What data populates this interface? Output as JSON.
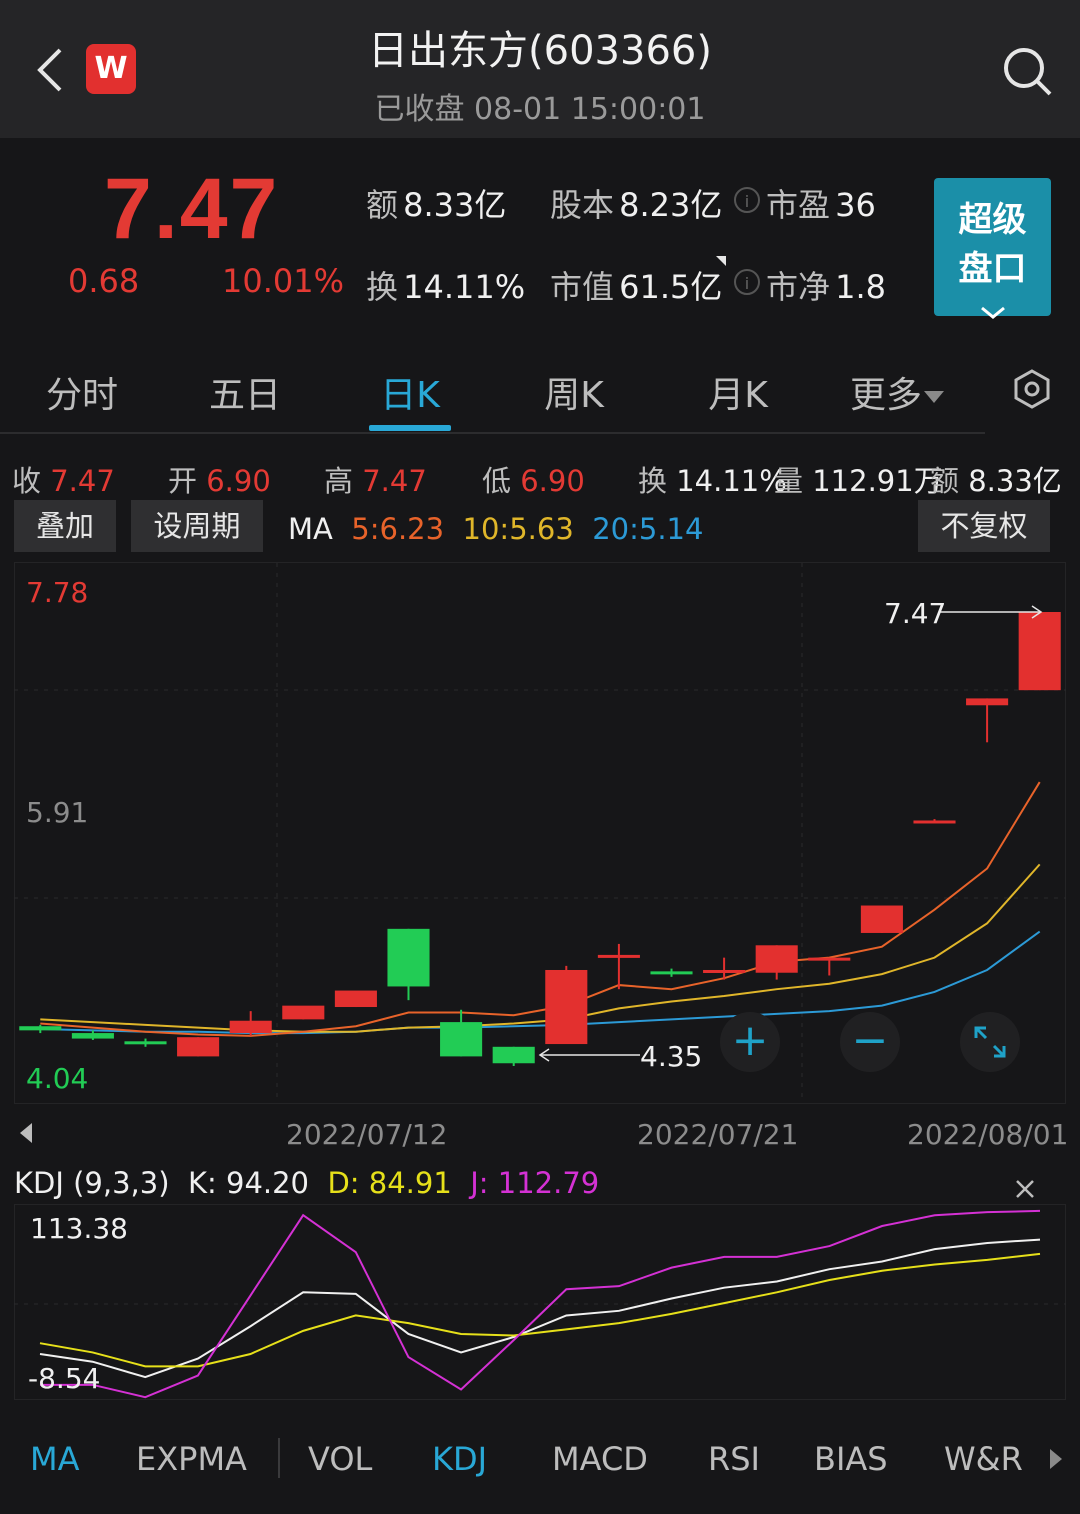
{
  "header": {
    "title": "日出东方(603366)",
    "subtitle": "已收盘 08-01 15:00:01",
    "logo_letter": "W"
  },
  "quote": {
    "price": "7.47",
    "change": "0.68",
    "change_pct": "10.01%",
    "amount_label": "额",
    "amount": "8.33亿",
    "shares_label": "股本",
    "shares": "8.23亿",
    "pe_label": "市盈",
    "pe": "36",
    "turnover_label": "换",
    "turnover": "14.11%",
    "mcap_label": "市值",
    "mcap": "61.5亿",
    "pb_label": "市净",
    "pb": "1.8",
    "super_line1": "超级",
    "super_line2": "盘口"
  },
  "tabs": [
    "分时",
    "五日",
    "日K",
    "周K",
    "月K",
    "更多"
  ],
  "active_tab": "日K",
  "stats": {
    "close_label": "收",
    "close": "7.47",
    "open_label": "开",
    "open": "6.90",
    "high_label": "高",
    "high": "7.47",
    "low_label": "低",
    "low": "6.90",
    "turn_label": "换",
    "turn": "14.11%",
    "vol_label": "量",
    "vol": "112.91万",
    "amt_label": "额",
    "amt": "8.33亿"
  },
  "buttons": {
    "overlay": "叠加",
    "period": "设周期",
    "adjust": "不复权"
  },
  "ma": {
    "label": "MA",
    "ma5": "5:6.23",
    "ma10": "10:5.63",
    "ma20": "20:5.14"
  },
  "colors": {
    "up": "#e3302f",
    "down": "#22cc55",
    "ma5": "#e8632a",
    "ma10": "#e0b62a",
    "ma20": "#2c9ad6",
    "k": "#f0f0f0",
    "d": "#e6e01a",
    "j": "#d431d4",
    "accent": "#29a8d6"
  },
  "chart_data": [
    {
      "type": "candlestick",
      "title": "",
      "y_labels": [
        "7.78",
        "5.91",
        "4.04"
      ],
      "ylim": [
        4.04,
        7.78
      ],
      "x_labels": [
        "2022/07/12",
        "2022/07/21",
        "2022/08/01"
      ],
      "max_marker": "7.47",
      "min_marker": "4.35",
      "candles": [
        {
          "o": 4.45,
          "h": 4.46,
          "c": 4.42,
          "l": 4.4
        },
        {
          "o": 4.4,
          "h": 4.42,
          "c": 4.36,
          "l": 4.35
        },
        {
          "o": 4.34,
          "h": 4.36,
          "c": 4.33,
          "l": 4.3
        },
        {
          "o": 4.23,
          "h": 4.37,
          "c": 4.37,
          "l": 4.23
        },
        {
          "o": 4.4,
          "h": 4.56,
          "c": 4.49,
          "l": 4.38
        },
        {
          "o": 4.5,
          "h": 4.57,
          "c": 4.6,
          "l": 4.5
        },
        {
          "o": 4.59,
          "h": 4.69,
          "c": 4.71,
          "l": 4.59
        },
        {
          "o": 5.16,
          "h": 5.16,
          "c": 4.74,
          "l": 4.64
        },
        {
          "o": 4.48,
          "h": 4.57,
          "c": 4.23,
          "l": 4.23
        },
        {
          "o": 4.3,
          "h": 4.3,
          "c": 4.18,
          "l": 4.16
        },
        {
          "o": 4.32,
          "h": 4.89,
          "c": 4.86,
          "l": 4.32
        },
        {
          "o": 4.95,
          "h": 5.05,
          "c": 4.97,
          "l": 4.72
        },
        {
          "o": 4.85,
          "h": 4.87,
          "c": 4.84,
          "l": 4.81
        },
        {
          "o": 4.85,
          "h": 4.95,
          "c": 4.86,
          "l": 4.79
        },
        {
          "o": 4.84,
          "h": 5.04,
          "c": 5.04,
          "l": 4.79
        },
        {
          "o": 4.93,
          "h": 4.95,
          "c": 4.95,
          "l": 4.82
        },
        {
          "o": 5.13,
          "h": 5.3,
          "c": 5.33,
          "l": 5.13
        },
        {
          "o": 5.94,
          "h": 5.96,
          "c": 5.95,
          "l": 5.94
        },
        {
          "o": 6.79,
          "h": 6.84,
          "c": 6.84,
          "l": 6.52
        },
        {
          "o": 6.9,
          "h": 7.47,
          "c": 7.47,
          "l": 6.9
        }
      ],
      "ma5": [
        4.47,
        4.44,
        4.41,
        4.39,
        4.38,
        4.41,
        4.45,
        4.55,
        4.55,
        4.53,
        4.6,
        4.75,
        4.72,
        4.8,
        4.92,
        4.95,
        5.03,
        5.3,
        5.6,
        6.23
      ],
      "ma10": [
        4.5,
        4.48,
        4.46,
        4.44,
        4.42,
        4.41,
        4.41,
        4.44,
        4.45,
        4.47,
        4.5,
        4.58,
        4.63,
        4.67,
        4.72,
        4.76,
        4.83,
        4.95,
        5.2,
        5.63
      ],
      "ma20": [
        4.43,
        4.42,
        4.41,
        4.41,
        4.4,
        4.4,
        4.41,
        4.44,
        4.44,
        4.45,
        4.46,
        4.48,
        4.5,
        4.52,
        4.54,
        4.56,
        4.6,
        4.7,
        4.86,
        5.14
      ]
    },
    {
      "type": "line",
      "title": "KDJ (9,3,3)",
      "k_label": "K: 94.20",
      "d_label": "D: 84.91",
      "j_label": "J: 112.79",
      "y_labels": [
        "113.38",
        "-8.54"
      ],
      "ylim": [
        -8.54,
        113.38
      ],
      "series": [
        {
          "name": "K",
          "values": [
            20.0,
            15.0,
            5.0,
            17.0,
            38.0,
            60.0,
            59.0,
            33.0,
            21.0,
            31.0,
            45.0,
            48.0,
            56.0,
            63.0,
            67.0,
            75.0,
            80.0,
            88.0,
            92.0,
            94.2
          ]
        },
        {
          "name": "D",
          "values": [
            27.0,
            21.0,
            12.0,
            12.0,
            20.0,
            35.0,
            45.0,
            40.0,
            33.0,
            32.0,
            36.0,
            40.0,
            46.0,
            53.0,
            60.0,
            68.0,
            74.0,
            78.0,
            81.0,
            84.91
          ]
        },
        {
          "name": "J",
          "values": [
            0.0,
            0.0,
            -8.0,
            6.0,
            58.0,
            110.0,
            86.0,
            18.0,
            -3.0,
            29.0,
            62.0,
            64.0,
            76.0,
            83.0,
            83.0,
            90.0,
            103.0,
            110.0,
            112.0,
            112.79
          ]
        }
      ]
    }
  ],
  "bottom_tabs": [
    "MA",
    "EXPMA",
    "VOL",
    "KDJ",
    "MACD",
    "RSI",
    "BIAS",
    "W&R"
  ],
  "active_bottom_tabs": [
    "MA",
    "KDJ"
  ],
  "icons": [
    "chevron-left-icon",
    "search-icon",
    "info-icon",
    "settings-icon",
    "plus-icon",
    "minus-icon",
    "expand-icon",
    "close-icon",
    "triangle-left-icon",
    "triangle-right-icon"
  ]
}
